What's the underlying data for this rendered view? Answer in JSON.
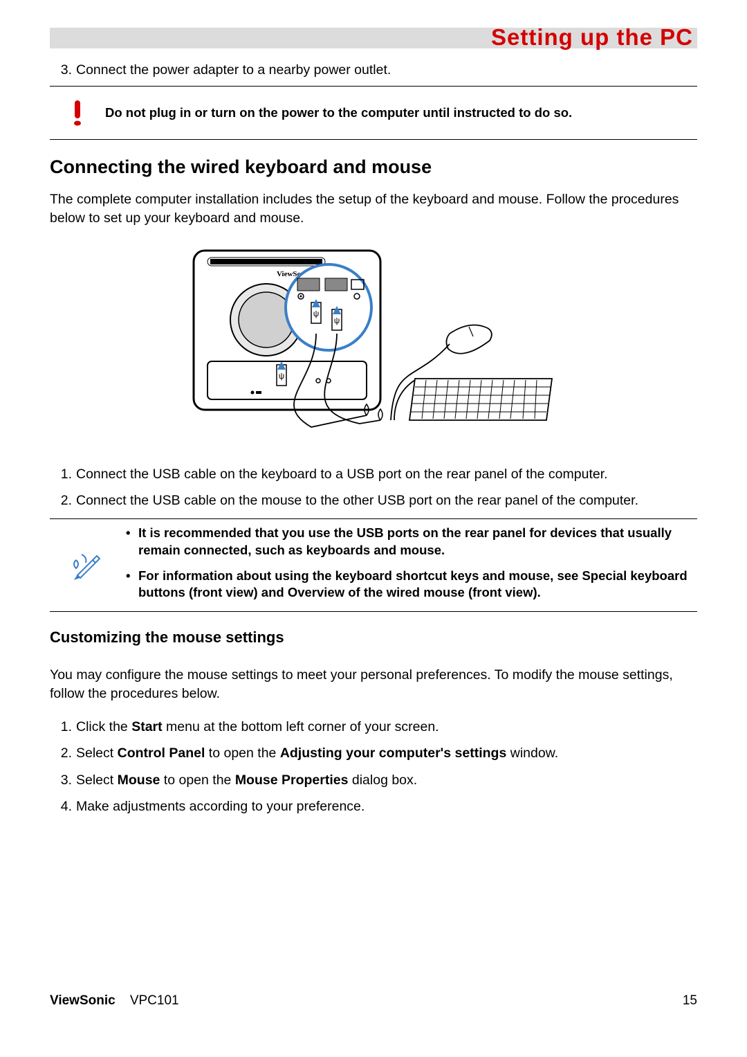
{
  "header": {
    "title": "Setting up the PC"
  },
  "top_step": {
    "num": "3.",
    "text": "Connect the power adapter to a nearby power outlet."
  },
  "warning": {
    "text": "Do not plug in or turn on the power to the computer until instructed to do so."
  },
  "section1": {
    "title": "Connecting the wired keyboard and mouse",
    "intro": "The complete computer installation includes the setup of the keyboard and mouse. Follow the procedures below to set up your keyboard and mouse.",
    "illustration_label": "ViewSon",
    "steps": [
      {
        "num": "1.",
        "text": "Connect the USB cable on the keyboard to a USB port on the rear panel of the computer."
      },
      {
        "num": "2.",
        "text": "Connect the USB cable on the mouse to the other USB port on the rear panel of the computer."
      }
    ],
    "notes": [
      {
        "text": "It is recommended that you use the USB ports on the rear panel for devices that usually remain connected, such as keyboards and mouse."
      },
      {
        "pre": "For information about using the keyboard shortcut keys and mouse, see ",
        "link1": "Special keyboard buttons (front view)",
        "mid": " and ",
        "link2": "Overview of the wired mouse (front view)",
        "post": "."
      }
    ]
  },
  "section2": {
    "title": "Customizing the mouse settings",
    "intro": "You may configure the mouse settings to meet your personal preferences. To modify the mouse settings, follow the procedures below.",
    "steps": [
      {
        "num": "1.",
        "pre": "Click the ",
        "b1": "Start",
        "post": " menu at the bottom left corner of your screen."
      },
      {
        "num": "2.",
        "pre": "Select ",
        "b1": "Control Panel",
        "mid": " to open the ",
        "b2": "Adjusting your computer's settings",
        "post": " window."
      },
      {
        "num": "3.",
        "pre": "Select ",
        "b1": "Mouse",
        "mid": " to open the ",
        "b2": "Mouse Properties",
        "post": " dialog box."
      },
      {
        "num": "4.",
        "text": "Make adjustments according to your preference."
      }
    ]
  },
  "footer": {
    "brand": "ViewSonic",
    "model": "VPC101",
    "page": "15"
  }
}
